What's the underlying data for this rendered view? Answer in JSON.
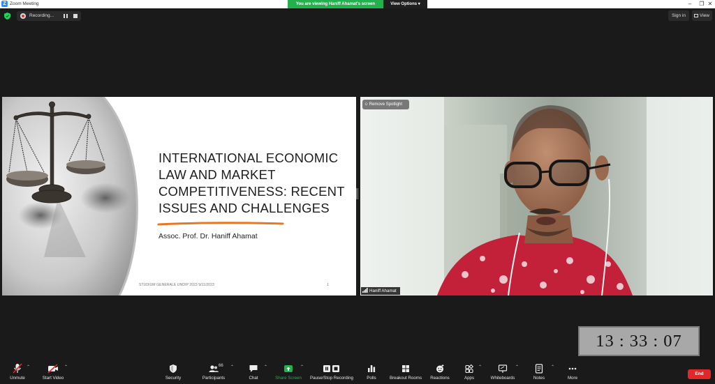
{
  "window": {
    "title": "Zoom Meeting"
  },
  "banner": {
    "message": "You are viewing Haniff Ahamat's screen",
    "view_options": "View Options"
  },
  "recording": {
    "status": "Recording..."
  },
  "top_right": {
    "sign_in": "Sign in",
    "view": "View"
  },
  "slide": {
    "title": "International Economic Law and Market Competitiveness: Recent Issues and Challenges",
    "author": "Assoc. Prof. Dr. Haniff Ahamat",
    "footer": "STUDIUM GENERALE UNDIP 2023 9/11/2023",
    "page": "1"
  },
  "video": {
    "remove_spotlight": "Remove Spotlight",
    "participant_name": "Haniff Ahamat"
  },
  "clock": {
    "time": "13 : 33 : 07"
  },
  "toolbar": {
    "unmute": "Unmute",
    "start_video": "Start Video",
    "security": "Security",
    "participants": "Participants",
    "participants_count": "66",
    "chat": "Chat",
    "share_screen": "Share Screen",
    "pause_stop_recording": "Pause/Stop Recording",
    "polls": "Polls",
    "breakout_rooms": "Breakout Rooms",
    "reactions": "Reactions",
    "apps": "Apps",
    "whiteboards": "Whiteboards",
    "notes": "Notes",
    "more": "More",
    "end": "End"
  },
  "colors": {
    "accent_green": "#22b14c",
    "end_red": "#e02828",
    "slide_underline": "#e87722",
    "zoom_blue": "#2d8cff"
  }
}
